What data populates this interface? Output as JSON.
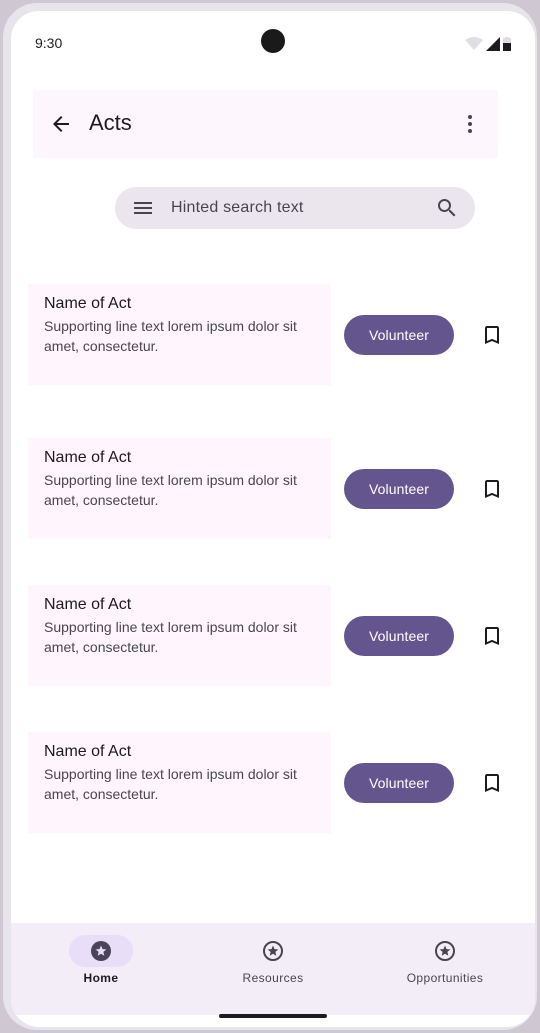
{
  "status_bar": {
    "time": "9:30"
  },
  "top_bar": {
    "title": "Acts"
  },
  "search": {
    "placeholder": "Hinted search text"
  },
  "acts": [
    {
      "name": "Name of Act",
      "supporting": "Supporting line text lorem ipsum dolor sit amet, consectetur.",
      "button": "Volunteer"
    },
    {
      "name": "Name of Act",
      "supporting": "Supporting line text lorem ipsum dolor sit amet, consectetur.",
      "button": "Volunteer"
    },
    {
      "name": "Name of Act",
      "supporting": "Supporting line text lorem ipsum dolor sit amet, consectetur.",
      "button": "Volunteer"
    },
    {
      "name": "Name of Act",
      "supporting": "Supporting line text lorem ipsum dolor sit amet, consectetur.",
      "button": "Volunteer"
    }
  ],
  "nav": {
    "items": [
      {
        "label": "Home",
        "icon": "star-circle-icon",
        "active": true
      },
      {
        "label": "Resources",
        "icon": "star-circle-icon",
        "active": false
      },
      {
        "label": "Opportunities",
        "icon": "star-circle-icon",
        "active": false
      }
    ]
  },
  "colors": {
    "primary": "#65558f",
    "surface": "#fef7ff",
    "nav_bg": "#f3edf7"
  }
}
